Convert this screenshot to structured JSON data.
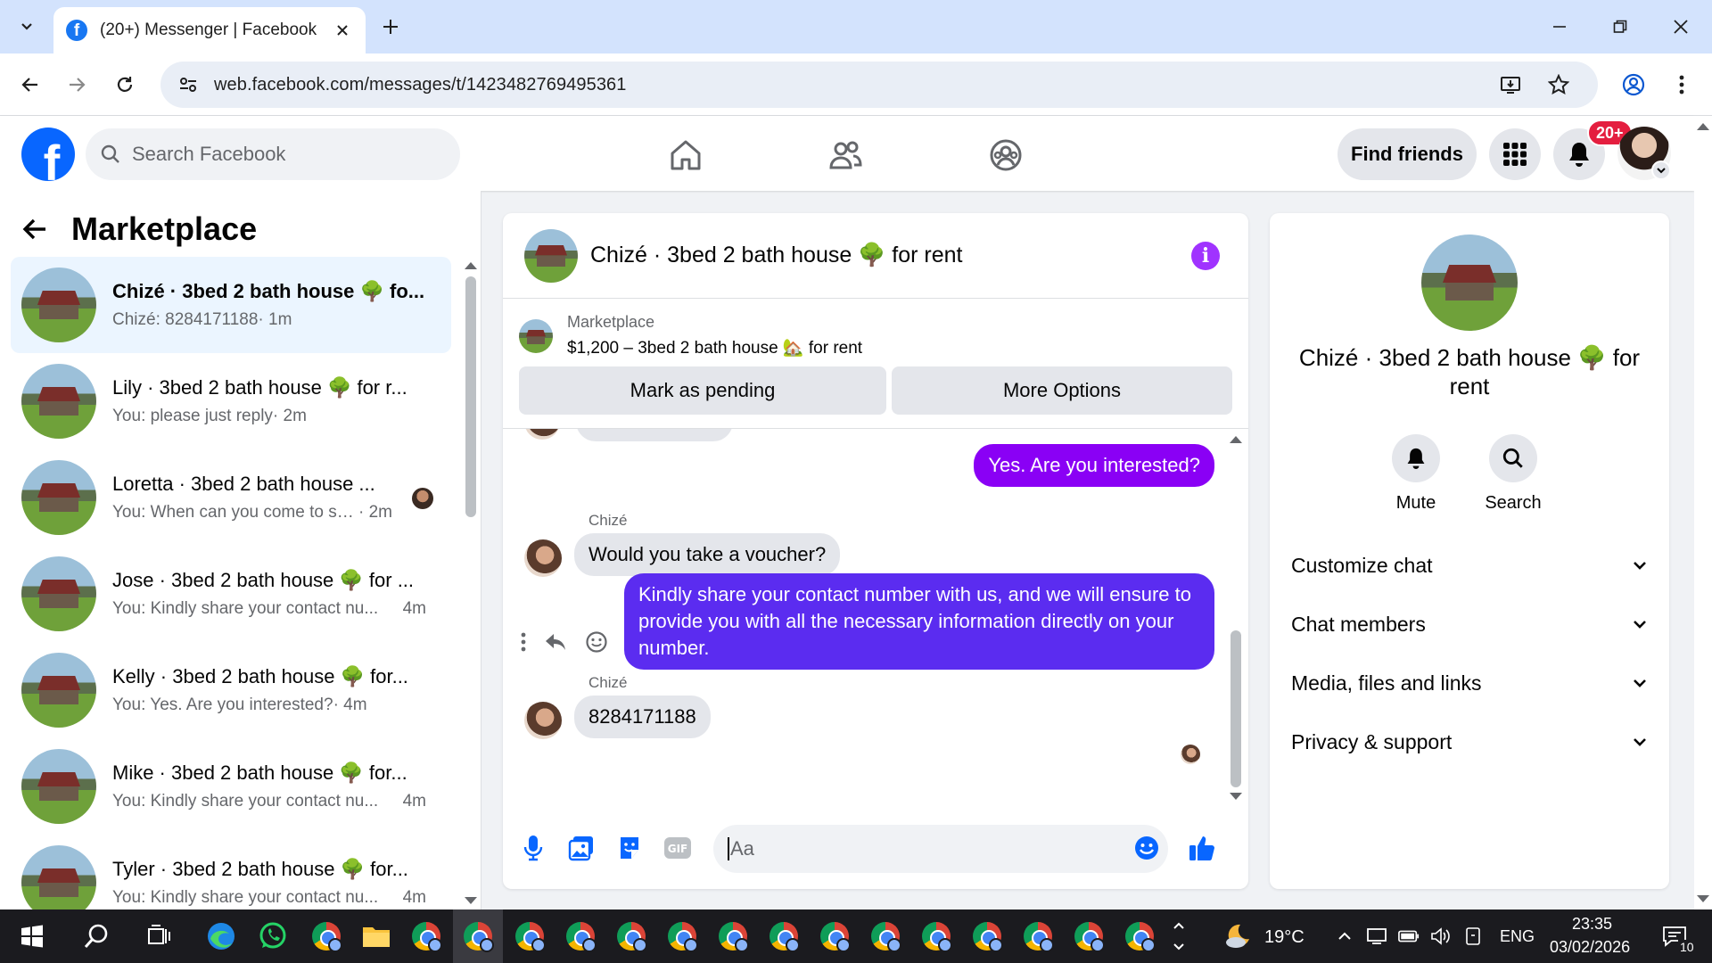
{
  "browser": {
    "tab_title": "(20+) Messenger | Facebook",
    "url": "web.facebook.com/messages/t/1423482769495361"
  },
  "facebook": {
    "search_placeholder": "Search Facebook",
    "find_friends": "Find friends",
    "notification_count": "20+",
    "brand_color": "#0866ff"
  },
  "marketplace": {
    "title": "Marketplace",
    "conversations": [
      {
        "name": "Chizé · 3bed 2 bath house 🌳 fo...",
        "preview": "Chizé: 8284171188",
        "time": "· 1m",
        "active": true
      },
      {
        "name": "Lily · 3bed 2 bath house 🌳 for r...",
        "preview": "You: please just reply",
        "time": "· 2m"
      },
      {
        "name": "Loretta · 3bed 2 bath house ...",
        "preview": "You: When can you come to se...",
        "time": " · 2m"
      },
      {
        "name": "Jose · 3bed 2 bath house 🌳 for ...",
        "preview": "You: Kindly share your contact nu...",
        "time": "4m"
      },
      {
        "name": "Kelly · 3bed 2 bath house 🌳 for...",
        "preview": "You: Yes. Are you interested?",
        "time": "· 4m"
      },
      {
        "name": "Mike · 3bed 2 bath house 🌳 for...",
        "preview": "You: Kindly share your contact nu...",
        "time": "4m"
      },
      {
        "name": "Tyler · 3bed 2 bath house 🌳 for...",
        "preview": "You: Kindly share your contact nu...",
        "time": "4m"
      }
    ]
  },
  "chat": {
    "title": "Chizé · 3bed 2 bath house 🌳 for rent",
    "listing_label": "Marketplace",
    "listing_price": "$1,200 – 3bed 2 bath house 🏡 for rent",
    "mark_pending": "Mark as pending",
    "more_options": "More Options",
    "messages": [
      {
        "from": "me",
        "text": "Yes. Are you interested?",
        "color": "#8a00f5"
      },
      {
        "from": "them",
        "sender": "Chizé",
        "text": "Would you take a voucher?"
      },
      {
        "from": "me",
        "text": "Kindly share your contact number with us, and we will ensure to provide you with all the necessary information directly on your number.",
        "color": "#5b2cf0"
      },
      {
        "from": "them",
        "sender": "Chizé",
        "text": "8284171188"
      }
    ],
    "composer_placeholder": "Aa"
  },
  "info_panel": {
    "name": "Chizé · 3bed 2 bath house 🌳 for rent",
    "mute": "Mute",
    "search": "Search",
    "sections": [
      "Customize chat",
      "Chat members",
      "Media, files and links",
      "Privacy & support"
    ]
  },
  "taskbar": {
    "weather": "19°C",
    "language": "ENG",
    "time": "23:35",
    "date": "03/02/2026",
    "notifications": "10"
  }
}
